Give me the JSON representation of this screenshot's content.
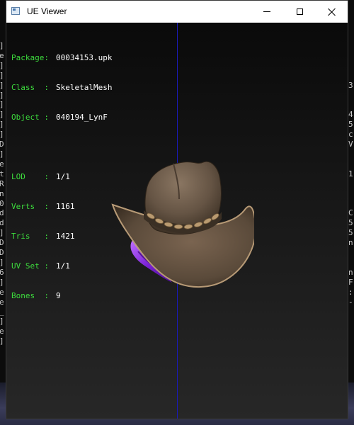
{
  "window": {
    "title": "UE Viewer",
    "icon": "app-window-icon",
    "controls": [
      "minimize-icon",
      "maximize-icon",
      "close-icon"
    ]
  },
  "info": {
    "package": {
      "label": "Package:",
      "value": "00034153.upk"
    },
    "class": {
      "label": "Class  :",
      "value": "SkeletalMesh"
    },
    "object": {
      "label": "Object :",
      "value": "040194_LynF"
    },
    "lod": {
      "label": "LOD    :",
      "value": "1/1"
    },
    "verts": {
      "label": "Verts  :",
      "value": "1161"
    },
    "tris": {
      "label": "Tris   :",
      "value": "1421"
    },
    "uvset": {
      "label": "UV Set :",
      "value": "1/1"
    },
    "bones": {
      "label": "Bones  :",
      "value": "9"
    }
  },
  "colors": {
    "label": "#3ddc3d",
    "value": "#ffffff",
    "axis": "#1a1ab8",
    "titlebar": "#ffffff"
  },
  "background": {
    "left_console": [
      "]",
      "e",
      "]",
      "]",
      "]",
      "]",
      "]",
      "]",
      "]",
      "]",
      "D",
      "]",
      "e",
      "t",
      "R",
      "n",
      "0",
      "d",
      "d",
      "]",
      "D",
      "D",
      "]",
      "6",
      "]",
      "e",
      "e",
      "_",
      "]",
      "e",
      "]"
    ],
    "right_console": [
      "",
      "",
      "",
      "",
      "3",
      "",
      "",
      "4",
      "5",
      "c",
      "V",
      "",
      "",
      "1",
      "",
      "",
      "",
      "C",
      "5",
      "5",
      "n",
      "",
      "",
      "n",
      "F",
      ":",
      "-"
    ]
  }
}
